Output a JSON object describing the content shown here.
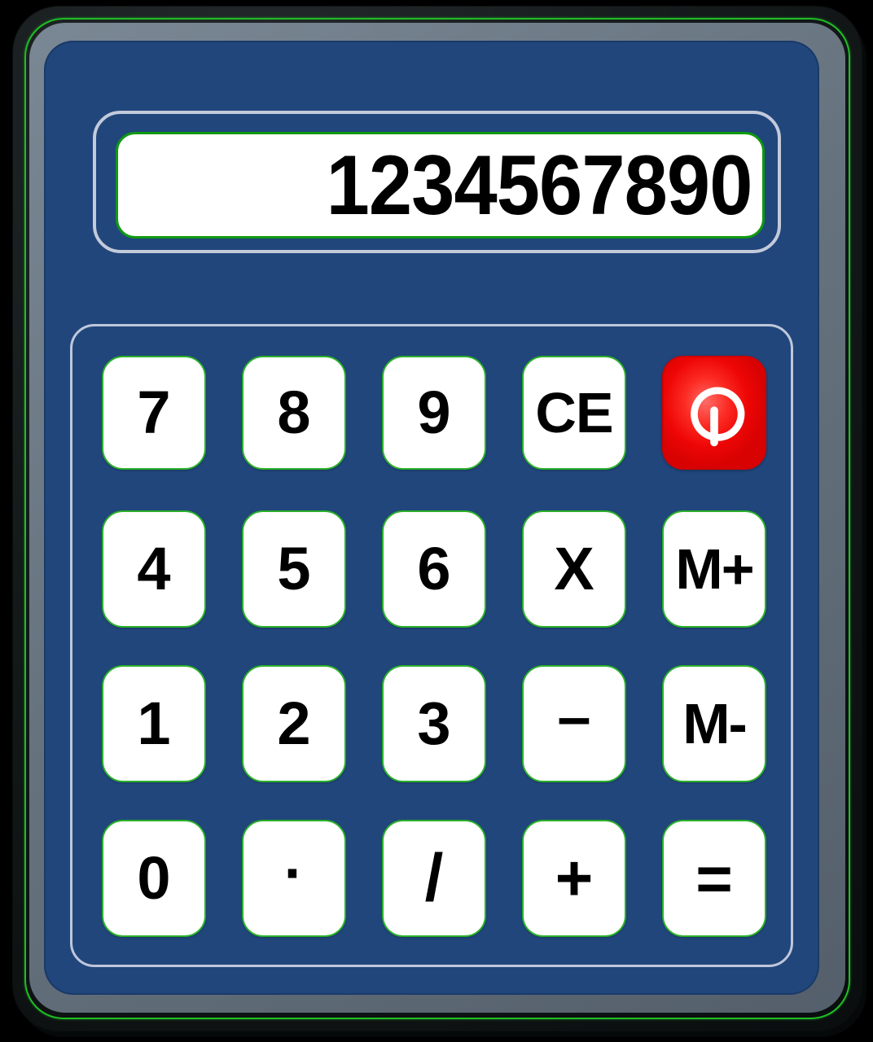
{
  "device": {
    "name": "Desktop Calculator",
    "body_color": "#21467c",
    "bezel_color": "#14191a",
    "accent_green": "#1fbe22",
    "steel_color": "#6d7b8a",
    "key_face_color": "#ffffff",
    "key_border_color": "#2ab02a",
    "power_key_color": "#ee0606"
  },
  "display": {
    "value": "1234567890",
    "alignment": "right",
    "screen_color": "#ffffff",
    "screen_border_color": "#0f9910",
    "frame_color": "#c3cada",
    "text_color": "#000000"
  },
  "keypad": {
    "panel_border_color": "#bfc7da",
    "rows": [
      [
        {
          "label": "7",
          "name": "key-7",
          "kind": "digit"
        },
        {
          "label": "8",
          "name": "key-8",
          "kind": "digit"
        },
        {
          "label": "9",
          "name": "key-9",
          "kind": "digit"
        },
        {
          "label": "CE",
          "name": "key-clear-entry",
          "kind": "function"
        },
        {
          "label": "",
          "name": "key-power",
          "kind": "power",
          "icon": "power-icon"
        }
      ],
      [
        {
          "label": "4",
          "name": "key-4",
          "kind": "digit"
        },
        {
          "label": "5",
          "name": "key-5",
          "kind": "digit"
        },
        {
          "label": "6",
          "name": "key-6",
          "kind": "digit"
        },
        {
          "label": "X",
          "name": "key-multiply",
          "kind": "operator"
        },
        {
          "label": "M+",
          "name": "key-memory-add",
          "kind": "memory"
        }
      ],
      [
        {
          "label": "1",
          "name": "key-1",
          "kind": "digit"
        },
        {
          "label": "2",
          "name": "key-2",
          "kind": "digit"
        },
        {
          "label": "3",
          "name": "key-3",
          "kind": "digit"
        },
        {
          "label": "–",
          "name": "key-subtract",
          "kind": "operator"
        },
        {
          "label": "M-",
          "name": "key-memory-subtract",
          "kind": "memory"
        }
      ],
      [
        {
          "label": "0",
          "name": "key-0",
          "kind": "digit"
        },
        {
          "label": "·",
          "name": "key-decimal-point",
          "kind": "operator"
        },
        {
          "label": "/",
          "name": "key-divide",
          "kind": "operator"
        },
        {
          "label": "+",
          "name": "key-add",
          "kind": "operator"
        },
        {
          "label": "=",
          "name": "key-equals",
          "kind": "operator"
        }
      ]
    ]
  }
}
